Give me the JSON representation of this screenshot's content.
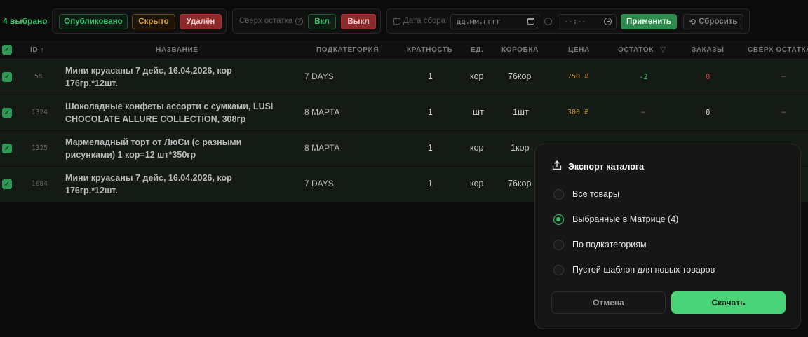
{
  "toolbar": {
    "selected_count": "4 выбрано",
    "published": "Опубликовано",
    "hidden": "Скрыто",
    "deleted": "Удалён",
    "over_stock_label": "Сверх остатка",
    "help_icon": "?",
    "on": "Вкл",
    "off": "Выкл",
    "date_label": "Дата сбора",
    "date_placeholder": "дд.мм.гггг",
    "time_placeholder": "--:--",
    "apply": "Применить",
    "reset": "Сбросить"
  },
  "table": {
    "headers": {
      "id": "ID ↑",
      "name": "НАЗВАНИЕ",
      "subcategory": "ПОДКАТЕГОРИЯ",
      "multiplicity": "КРАТНОСТЬ",
      "unit": "ЕД.",
      "box": "КОРОБКА",
      "price": "ЦЕНА",
      "stock": "ОСТАТОК",
      "orders": "ЗАКАЗЫ",
      "over_stock": "СВЕРХ ОСТАТКА"
    },
    "rows": [
      {
        "id": "58",
        "name": "Мини круасаны 7 дейс, 16.04.2026, кор 176гр.*12шт.",
        "subcategory": "7 DAYS",
        "multiplicity": "1",
        "unit": "кор",
        "box": "76кор",
        "price": "750 ₽",
        "stock": "-2",
        "orders": "0",
        "over": "–"
      },
      {
        "id": "1324",
        "name": "Шоколадные конфеты ассорти с сумками, LUSI CHOCOLATE ALLURE COLLECTION, 308гр",
        "subcategory": "8 МАРТА",
        "multiplicity": "1",
        "unit": "шт",
        "box": "1шт",
        "price": "300 ₽",
        "stock": "–",
        "orders": "0",
        "over": "–"
      },
      {
        "id": "1325",
        "name": "Мармеладный торт от ЛюСи (с разными рисунками) 1 кор=12 шт*350гр",
        "subcategory": "8 МАРТА",
        "multiplicity": "1",
        "unit": "кор",
        "box": "1кор"
      },
      {
        "id": "1684",
        "name": "Мини круасаны 7 дейс, 16.04.2026, кор 176гр.*12шт.",
        "subcategory": "7 DAYS",
        "multiplicity": "1",
        "unit": "кор",
        "box": "76кор"
      }
    ],
    "check_mark": "✓"
  },
  "modal": {
    "title": "Экспорт каталога",
    "options": [
      {
        "label": "Все товары",
        "selected": false
      },
      {
        "label": "Выбранные в Матрице (4)",
        "selected": true
      },
      {
        "label": "По подкатегориям",
        "selected": false
      },
      {
        "label": "Пустой шаблон для новых товаров",
        "selected": false
      }
    ],
    "cancel": "Отмена",
    "download": "Скачать"
  },
  "colors": {
    "accent": "#4ad47a",
    "row_bg": "#141a14",
    "price": "#c9953e",
    "danger": "#8b2a2a"
  }
}
